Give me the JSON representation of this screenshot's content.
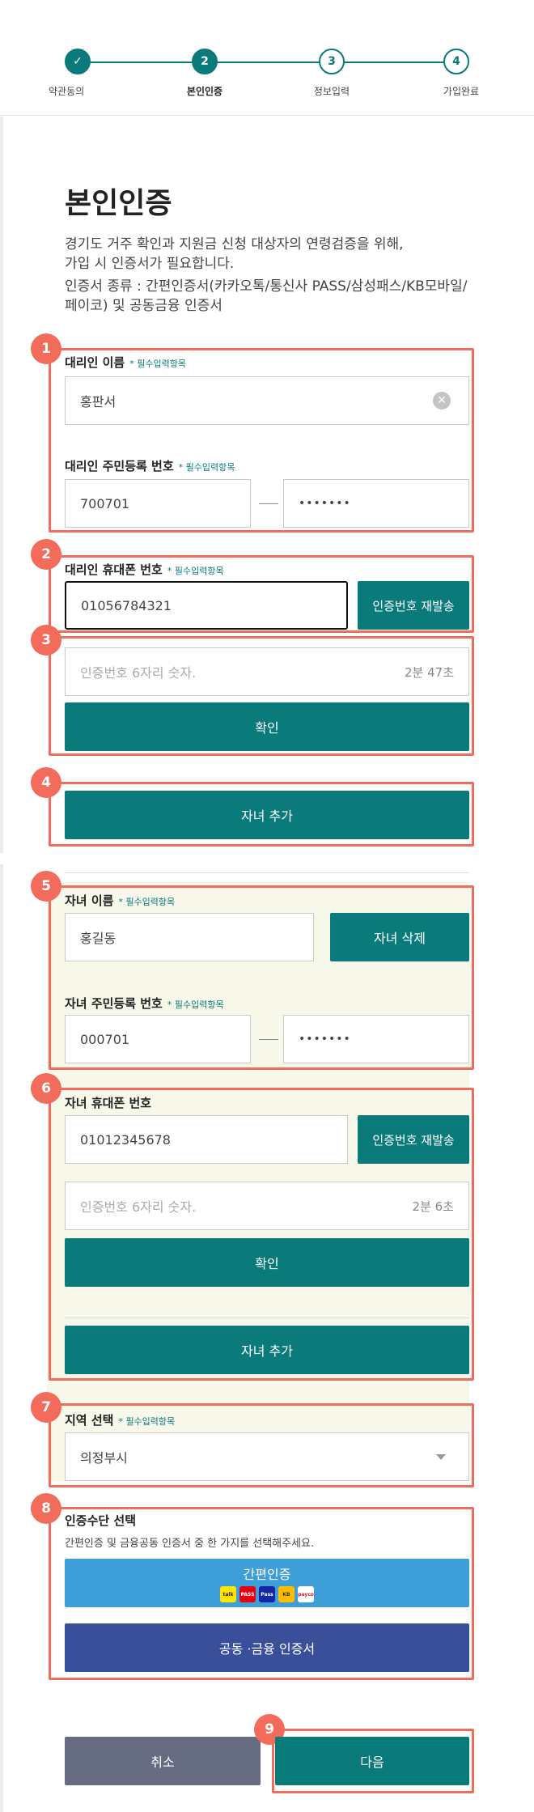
{
  "steps": [
    {
      "label": "약관동의",
      "num": "✓"
    },
    {
      "label": "본인인증",
      "num": "2"
    },
    {
      "label": "정보입력",
      "num": "3"
    },
    {
      "label": "가입완료",
      "num": "4"
    }
  ],
  "page_title": "본인인증",
  "description": {
    "line1": "경기도 거주 확인과 지원금 신청 대상자의 연령검증을 위해,",
    "line2": "가입 시 인증서가 필요합니다.",
    "line3": "인증서 종류 : 간편인증서(카카오톡/통신사 PASS/삼성패스/KB모바일/",
    "line4": "페이코) 및 공동금융 인증서"
  },
  "badges": [
    "1",
    "2",
    "3",
    "4",
    "5",
    "6",
    "7",
    "8",
    "9"
  ],
  "required_label": "필수입력항목",
  "agent": {
    "name_label": "대리인 이름",
    "name_value": "홍판서",
    "rrn_label": "대리인 주민등록 번호",
    "rrn_front": "700701",
    "rrn_back": "•••••••",
    "phone_label": "대리인 휴대폰 번호",
    "phone_value": "01056784321",
    "resend_label": "인증번호 재발송",
    "code_placeholder": "인증번호 6자리 숫자.",
    "timer": "2분 47초",
    "confirm_label": "확인"
  },
  "add_child_label": "자녀 추가",
  "child": {
    "name_label": "자녀 이름",
    "name_value": "홍길동",
    "delete_label": "자녀 삭제",
    "rrn_label": "자녀 주민등록 번호",
    "rrn_front": "000701",
    "rrn_back": "•••••••",
    "phone_label": "자녀 휴대폰 번호",
    "phone_value": "01012345678",
    "resend_label": "인증번호 재발송",
    "code_placeholder": "인증번호 6자리 숫자.",
    "timer": "2분 6초",
    "confirm_label": "확인",
    "add_child_label": "자녀 추가"
  },
  "region": {
    "label": "지역 선택",
    "value": "의정부시"
  },
  "auth_method": {
    "label": "인증수단 선택",
    "hint": "간편인증 및 금융공동 인증서 중 한 가지를 선택해주세요.",
    "simple_label": "간편인증",
    "joint_label": "공동 ·금융 인증서",
    "logos": [
      "talk",
      "PASS",
      "Pass",
      "KB",
      "payco"
    ]
  },
  "footer": {
    "cancel_label": "취소",
    "next_label": "다음"
  },
  "colors": {
    "accent": "#0b7a7a",
    "highlight": "#f26b5b",
    "simple_auth": "#3d9ed8",
    "joint_auth": "#3a4f9a",
    "cancel": "#666d82"
  }
}
